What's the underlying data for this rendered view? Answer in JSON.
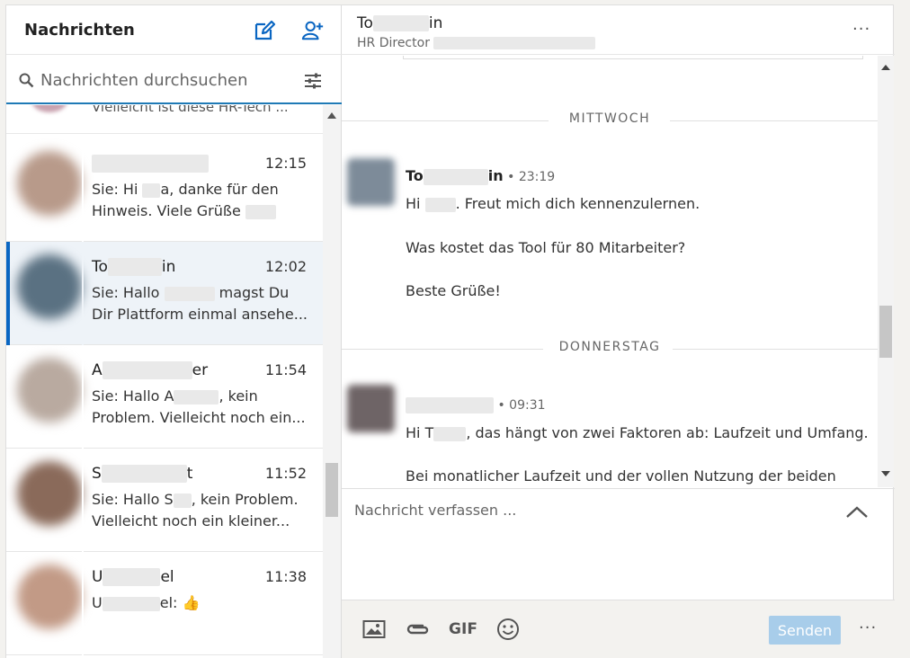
{
  "sidebar": {
    "title": "Nachrichten",
    "search_placeholder": "Nachrichten durchsuchen",
    "partial_preview": "Vielleicht ist diese HR-Tech ...",
    "conversations": [
      {
        "name": "",
        "time": "12:15",
        "preview_a": "Sie: Hi ",
        "preview_b": "a, danke für den",
        "preview_c": "Hinweis. Viele Grüße ",
        "avatar_color": "#b89a8a"
      },
      {
        "name_a": "To",
        "name_b": "in",
        "time": "12:02",
        "preview_a": "Sie: Hallo ",
        "preview_b": " magst Du",
        "preview_c": "Dir Plattform einmal ansehe...",
        "avatar_color": "#5a7182"
      },
      {
        "name_a": "A",
        "name_b": "er",
        "time": "11:54",
        "preview_a": "Sie: Hallo A",
        "preview_b": ", kein",
        "preview_c": "Problem.  Vielleicht noch ein...",
        "avatar_color": "#b9aaa0"
      },
      {
        "name_a": "S",
        "name_b": "t",
        "time": "11:52",
        "preview_a": "Sie: Hallo S",
        "preview_b": ", kein Problem.",
        "preview_c": "Vielleicht noch ein kleiner...",
        "avatar_color": "#8a6a5a"
      },
      {
        "name_a": "U",
        "name_b": "el",
        "time": "11:38",
        "preview_a": "U",
        "preview_b": "el: 👍",
        "avatar_color": "#c29a86"
      }
    ]
  },
  "thread": {
    "contact_name_a": "To",
    "contact_name_b": "in",
    "contact_subtitle": "HR Director ",
    "day1": "MITTWOCH",
    "day2": "DONNERSTAG",
    "msg1": {
      "sender_a": "To",
      "sender_b": "in",
      "time": " • 23:19",
      "line1_a": "Hi ",
      "line1_b": ". Freut mich dich kennenzulernen.",
      "line2": "Was kostet das Tool für 80 Mitarbeiter?",
      "line3": "Beste Grüße!",
      "avatar_color": "#7d8b99"
    },
    "msg2": {
      "time": " • 09:31",
      "line1_a": "Hi T",
      "line1_b": ", das hängt von zwei Faktoren ab: Laufzeit und Umfang.",
      "line2": "Bei monatlicher Laufzeit und der vollen Nutzung der beiden",
      "avatar_color": "#6e6466"
    }
  },
  "compose": {
    "placeholder": "Nachricht verfassen ...",
    "gif_label": "GIF",
    "send_label": "Senden",
    "more": "···"
  },
  "header_more": "···",
  "colors": {
    "accent": "#0a66c2",
    "send_disabled": "#a8cdea",
    "active_row": "#eef3f8"
  }
}
